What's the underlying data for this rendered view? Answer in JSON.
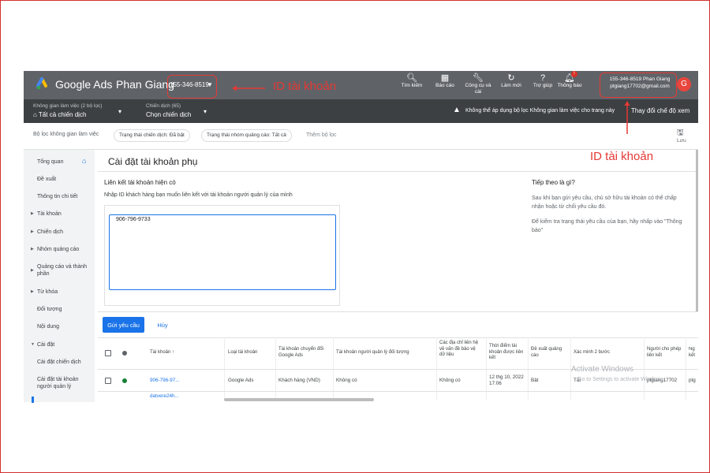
{
  "topbar": {
    "brand": "Google Ads",
    "account_name": "Phan Giang",
    "account_id": "155-346-8519",
    "tools": [
      {
        "icon": "search-icon",
        "label": "Tìm kiếm"
      },
      {
        "icon": "reports-icon",
        "label": "Báo cáo"
      },
      {
        "icon": "tools-icon",
        "label": "Công cụ và cài"
      },
      {
        "icon": "refresh-icon",
        "label": "Làm mới"
      },
      {
        "icon": "help-icon",
        "label": "Trợ giúp"
      },
      {
        "icon": "notifications-icon",
        "label": "Thông báo"
      }
    ],
    "notification_badge": "!",
    "right_id": "155-346-8519 Phan Giang",
    "right_email": "ptgiang17702@gmail.com",
    "avatar_letter": "G"
  },
  "subbar": {
    "workspace_small": "Không gian làm việc (2 bộ lọc)",
    "workspace_main": "Tất cả chiến dịch",
    "campaign_small": "Chiến dịch (65)",
    "campaign_main": "Chọn chiến dịch",
    "warning": "Không thể áp dụng bộ lọc Không gian làm việc cho trang này",
    "change_view": "Thay đổi chế độ xem"
  },
  "filterbar": {
    "label": "Bộ lọc không gian làm việc",
    "chip1": "Trạng thái chiến dịch: Đã bật",
    "chip2": "Trạng thái nhóm quảng cáo: Tất cả",
    "add_filter": "Thêm bộ lọc",
    "save": "Lưu"
  },
  "sidebar": {
    "items": [
      {
        "label": "Tổng quan"
      },
      {
        "label": "Đề xuất"
      },
      {
        "label": "Thông tin chi tiết"
      },
      {
        "label": "Tài khoản"
      },
      {
        "label": "Chiến dịch"
      },
      {
        "label": "Nhóm quảng cáo"
      },
      {
        "label": "Quảng cáo và thành phần"
      },
      {
        "label": "Từ khóa"
      },
      {
        "label": "Đối tượng"
      },
      {
        "label": "Nội dung"
      },
      {
        "label": "Cài đặt"
      },
      {
        "label": "Cài đặt chiến dịch"
      },
      {
        "label": "Cài đặt tài khoản người quản lý"
      }
    ]
  },
  "main": {
    "title": "Cài đặt tài khoản phụ",
    "section_title": "Liên kết tài khoản hiện có",
    "section_desc": "Nhập ID khách hàng bạn muốn liên kết với tài khoản người quản lý của mình",
    "input_value": "906-796-9733",
    "next_title": "Tiếp theo là gì?",
    "next_p1": "Sau khi bạn gửi yêu cầu, chủ sở hữu tài khoản có thể chấp nhận hoặc từ chối yêu cầu đó.",
    "next_p2": "Để kiểm tra trạng thái yêu cầu của bạn, hãy nhấp vào \"Thông báo\"",
    "send_button": "Gửi yêu cầu",
    "cancel_button": "Hủy"
  },
  "table": {
    "columns": [
      "Tài khoản ↑",
      "Loại tài khoản",
      "Tài khoản chuyển đổi Google Ads",
      "Tài khoản người quản lý đối tượng",
      "Các địa chỉ liên hệ về vấn đề bảo vệ dữ liệu",
      "Thời điểm tài khoản được liên kết",
      "Đề xuất quảng cáo",
      "Xác minh 2 bước",
      "Người cho phép liên kết",
      "Ng kết"
    ],
    "rows": [
      {
        "account": "906-796-97...",
        "type": "Google Ads",
        "conversion": "Khách hàng (VND)",
        "manager": "Không có",
        "contacts": "Không có",
        "linked_time": "12 thg 10, 2022 17:06",
        "suggestions": "Bật",
        "two_step": "Tắt",
        "approver": "ptgiang17702",
        "extra": "ptg",
        "status_color": "#188038"
      },
      {
        "account": "datvere24h..."
      }
    ]
  },
  "annotations": {
    "label_left": "ID tài khoản",
    "label_right": "ID tài khoản",
    "color": "#e53935"
  },
  "watermark": {
    "line1": "Activate Windows",
    "line2": "Go to Settings to activate Windows."
  }
}
